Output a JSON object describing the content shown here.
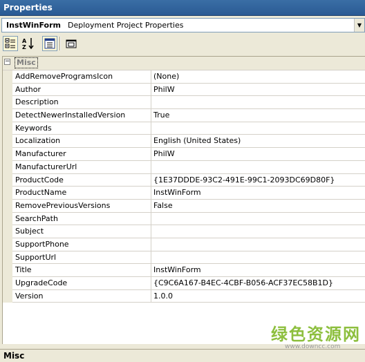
{
  "window": {
    "title": "Properties"
  },
  "object_selector": {
    "name": "InstWinForm",
    "type": "Deployment Project Properties",
    "dropdown_icon": "chevron-down-icon"
  },
  "toolbar": {
    "buttons": [
      {
        "icon": "categorized-icon",
        "pressed": true
      },
      {
        "icon": "alphabetical-icon",
        "pressed": false
      },
      {
        "icon": "properties-icon",
        "pressed": true
      },
      {
        "icon": "property-pages-icon",
        "pressed": false
      }
    ]
  },
  "category": {
    "label": "Misc",
    "toggle": "⊟"
  },
  "properties": [
    {
      "name": "AddRemoveProgramsIcon",
      "value": "(None)"
    },
    {
      "name": "Author",
      "value": "PhilW"
    },
    {
      "name": "Description",
      "value": ""
    },
    {
      "name": "DetectNewerInstalledVersion",
      "value": "True"
    },
    {
      "name": "Keywords",
      "value": ""
    },
    {
      "name": "Localization",
      "value": "English (United States)"
    },
    {
      "name": "Manufacturer",
      "value": "PhilW"
    },
    {
      "name": "ManufacturerUrl",
      "value": ""
    },
    {
      "name": "ProductCode",
      "value": "{1E37DDDE-93C2-491E-99C1-2093DC69D80F}"
    },
    {
      "name": "ProductName",
      "value": "InstWinForm"
    },
    {
      "name": "RemovePreviousVersions",
      "value": "False"
    },
    {
      "name": "SearchPath",
      "value": ""
    },
    {
      "name": "Subject",
      "value": ""
    },
    {
      "name": "SupportPhone",
      "value": ""
    },
    {
      "name": "SupportUrl",
      "value": ""
    },
    {
      "name": "Title",
      "value": "InstWinForm"
    },
    {
      "name": "UpgradeCode",
      "value": "{C9C6A167-B4EC-4CBF-B056-ACF37EC58B1D}"
    },
    {
      "name": "Version",
      "value": "1.0.0"
    }
  ],
  "status": {
    "label": "Misc"
  },
  "watermark": {
    "text": "绿色资源网",
    "url": "www.downcc.com"
  }
}
